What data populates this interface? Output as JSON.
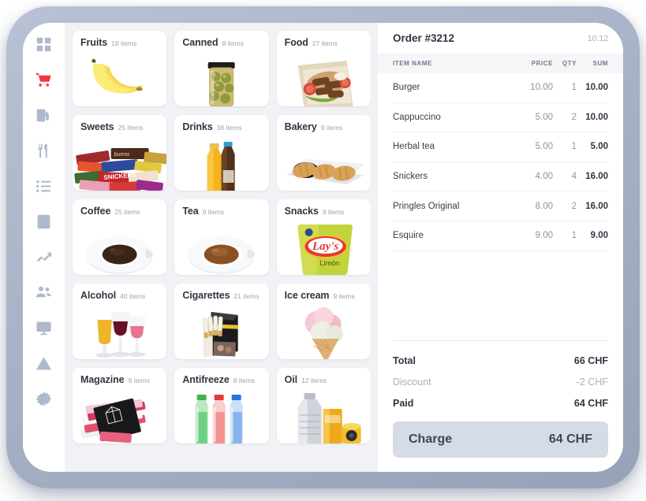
{
  "sidebar": {
    "items": [
      {
        "icon": "dashboard-grid-icon",
        "name": "dashboard",
        "active": false
      },
      {
        "icon": "shopping-cart-icon",
        "name": "sales",
        "active": true
      },
      {
        "icon": "fuel-pump-icon",
        "name": "fuel",
        "active": false
      },
      {
        "icon": "cutlery-icon",
        "name": "kitchen",
        "active": false
      },
      {
        "icon": "list-icon",
        "name": "orders",
        "active": false
      },
      {
        "icon": "contact-card-icon",
        "name": "customers",
        "active": false
      },
      {
        "icon": "trending-up-icon",
        "name": "reports",
        "active": false
      },
      {
        "icon": "users-group-icon",
        "name": "staff",
        "active": false
      },
      {
        "icon": "monitor-icon",
        "name": "terminals",
        "active": false
      },
      {
        "icon": "warning-triangle-icon",
        "name": "alerts",
        "active": false
      },
      {
        "icon": "gear-icon",
        "name": "settings",
        "active": false
      }
    ]
  },
  "catalog": {
    "categories": [
      {
        "title": "Fruits",
        "count": "18 items",
        "art": "bananas"
      },
      {
        "title": "Canned",
        "count": "8 items",
        "art": "olive-jar"
      },
      {
        "title": "Food",
        "count": "27 items",
        "art": "sandwich"
      },
      {
        "title": "Sweets",
        "count": "25 items",
        "art": "candy-bars"
      },
      {
        "title": "Drinks",
        "count": "38 items",
        "art": "bottles"
      },
      {
        "title": "Bakery",
        "count": "9 items",
        "art": "croissants"
      },
      {
        "title": "Coffee",
        "count": "25 items",
        "art": "coffee-cup"
      },
      {
        "title": "Tea",
        "count": "9 items",
        "art": "tea-cup"
      },
      {
        "title": "Snacks",
        "count": "9 items",
        "art": "chips-bag"
      },
      {
        "title": "Alcohol",
        "count": "40 items",
        "art": "wine-glasses"
      },
      {
        "title": "Cigarettes",
        "count": "21 items",
        "art": "cigarette-pack"
      },
      {
        "title": "Ice cream",
        "count": "9 items",
        "art": "ice-cream-cone"
      },
      {
        "title": "Magazine",
        "count": "9 items",
        "art": "magazines"
      },
      {
        "title": "Antifreeze",
        "count": "8 items",
        "art": "antifreeze-bottles"
      },
      {
        "title": "Oil",
        "count": "12 items",
        "art": "oil-canister"
      }
    ]
  },
  "order": {
    "title": "Order #3212",
    "time": "10:12",
    "columns": {
      "name": "ITEM NAME",
      "price": "PRICE",
      "qty": "QTY",
      "sum": "SUM"
    },
    "items": [
      {
        "name": "Burger",
        "price": "10.00",
        "qty": "1",
        "sum": "10.00"
      },
      {
        "name": "Cappuccino",
        "price": "5.00",
        "qty": "2",
        "sum": "10.00"
      },
      {
        "name": "Herbal tea",
        "price": "5.00",
        "qty": "1",
        "sum": "5.00"
      },
      {
        "name": "Snickers",
        "price": "4.00",
        "qty": "4",
        "sum": "16.00"
      },
      {
        "name": "Pringles Original",
        "price": "8.00",
        "qty": "2",
        "sum": "16.00"
      },
      {
        "name": "Esquire",
        "price": "9.00",
        "qty": "1",
        "sum": "9.00"
      }
    ],
    "totals": {
      "total_label": "Total",
      "total_value": "66 CHF",
      "discount_label": "Discount",
      "discount_value": "-2 CHF",
      "paid_label": "Paid",
      "paid_value": "64 CHF"
    },
    "charge": {
      "label": "Charge",
      "amount": "64 CHF"
    }
  },
  "colors": {
    "accent_red": "#f2383a",
    "icon_grey": "#aeb9cc",
    "charge_bg": "#d5dce6",
    "charge_text": "#3c4758",
    "catalog_bg": "#f1f2f5",
    "bezel": "#a8b2c6"
  }
}
